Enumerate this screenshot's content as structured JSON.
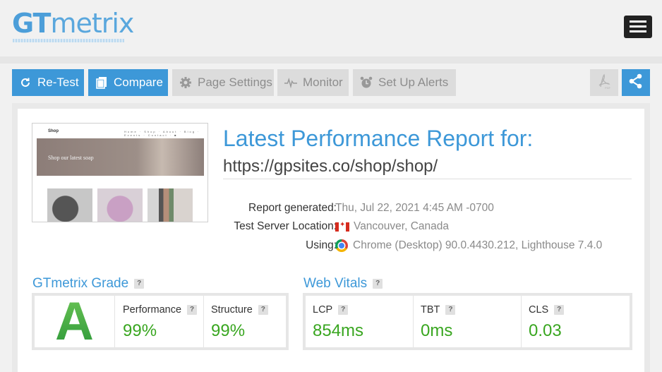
{
  "app": {
    "logo_strong": "GT",
    "logo_light": "metrix"
  },
  "toolbar": {
    "retest": "Re-Test",
    "compare": "Compare",
    "page_settings": "Page Settings",
    "monitor": "Monitor",
    "alerts": "Set Up Alerts"
  },
  "report": {
    "title": "Latest Performance Report for:",
    "url": "https://gpsites.co/shop/shop/",
    "generated_label": "Report generated:",
    "generated_value": "Thu, Jul 22, 2021 4:45 AM -0700",
    "location_label": "Test Server Location:",
    "location_value": "Vancouver, Canada",
    "using_label": "Using:",
    "using_value": "Chrome (Desktop) 90.0.4430.212, Lighthouse 7.4.0"
  },
  "thumbnail": {
    "site_name": "Shop",
    "nav": "Home · Shop · About · Blog · Events · Contact · ■",
    "hero_text": "Shop our latest soap"
  },
  "grade": {
    "title": "GTmetrix Grade",
    "help": "?",
    "letter": "A",
    "performance_label": "Performance",
    "performance_value": "99%",
    "structure_label": "Structure",
    "structure_value": "99%"
  },
  "vitals": {
    "title": "Web Vitals",
    "help": "?",
    "lcp_label": "LCP",
    "lcp_value": "854ms",
    "tbt_label": "TBT",
    "tbt_value": "0ms",
    "cls_label": "CLS",
    "cls_value": "0.03"
  },
  "colors": {
    "accent": "#3d98d8",
    "good": "#39a620",
    "disabled": "#dcdcdc"
  },
  "icons": {
    "retest": "refresh-icon",
    "compare": "copy-icon",
    "page_settings": "gear-icon",
    "monitor": "pulse-icon",
    "alerts": "alarm-clock-icon",
    "pdf": "pdf-icon",
    "share": "share-icon",
    "menu": "hamburger-icon"
  }
}
